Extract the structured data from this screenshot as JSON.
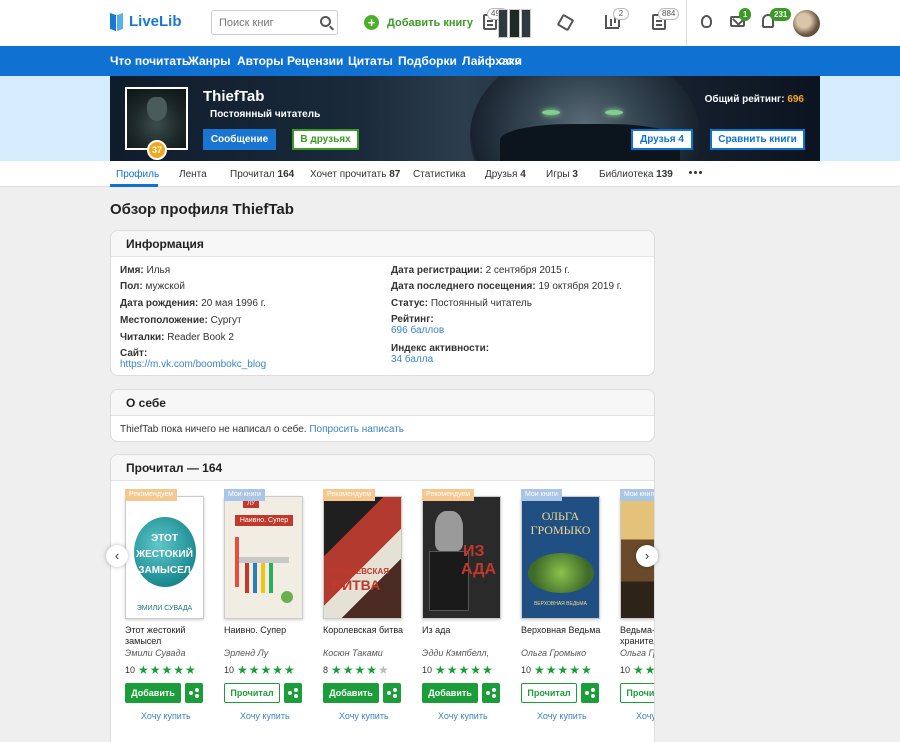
{
  "header": {
    "logo": "LiveLib",
    "search_placeholder": "Поиск книг",
    "add_book": "Добавить книгу",
    "counts": {
      "reading": "495",
      "stats": "2",
      "docs": "884"
    },
    "badges": {
      "mail": "1",
      "notifications": "231"
    }
  },
  "nav": {
    "items": [
      "Что почитать",
      "Жанры",
      "Авторы",
      "Рецензии",
      "Цитаты",
      "Подборки",
      "Лайфхаки"
    ]
  },
  "profile": {
    "username": "ThiefTab",
    "status": "Постоянный читатель",
    "level": "37",
    "message_button": "Сообщение",
    "friend_button": "В друзьях",
    "rating_label": "Общий рейтинг:",
    "rating_value": "696",
    "friends_button": "Друзья 4",
    "compare_button": "Сравнить книги"
  },
  "tabs": [
    {
      "label": "Профиль",
      "count": ""
    },
    {
      "label": "Лента",
      "count": ""
    },
    {
      "label": "Прочитал",
      "count": "164"
    },
    {
      "label": "Хочет прочитать",
      "count": "87"
    },
    {
      "label": "Статистика",
      "count": ""
    },
    {
      "label": "Друзья",
      "count": "4"
    },
    {
      "label": "Игры",
      "count": "3"
    },
    {
      "label": "Библиотека",
      "count": "139"
    }
  ],
  "page_title": "Обзор профиля ThiefTab",
  "info": {
    "heading": "Информация",
    "name": {
      "label": "Имя:",
      "value": "Илья"
    },
    "gender": {
      "label": "Пол:",
      "value": "мужской"
    },
    "birthday": {
      "label": "Дата рождения:",
      "value": "20 мая 1996 г."
    },
    "location": {
      "label": "Местоположение:",
      "value": "Сургут"
    },
    "readers": {
      "label": "Читалки:",
      "value": "Reader Book 2"
    },
    "site": {
      "label": "Сайт:",
      "value": "https://m.vk.com/boombokc_blog"
    },
    "registered": {
      "label": "Дата регистрации:",
      "value": "2 сентября 2015 г."
    },
    "last_visit": {
      "label": "Дата последнего посещения:",
      "value": "19 октября 2019 г."
    },
    "status": {
      "label": "Статус:",
      "value": "Постоянный читатель"
    },
    "rating": {
      "label": "Рейтинг:",
      "value": "696 баллов"
    },
    "activity": {
      "label": "Индекс активности:",
      "value": "34 балла"
    }
  },
  "about": {
    "heading": "О себе",
    "text": "ThiefTab пока ничего не написал о себе.",
    "link": "Попросить написать"
  },
  "read": {
    "heading": "Прочитал — 164",
    "books": [
      {
        "ribbon": "Рекомендуем",
        "title": "Этот жестокий замысел",
        "author": "Эмили Сувада",
        "score": "10",
        "stars": 5,
        "action": "Добавить",
        "buy": "Хочу купить",
        "cover_lines": [
          "ЭТОТ",
          "ЖЕСТОКИЙ",
          "ЗАМЫСЕЛ"
        ],
        "cover_author": "ЭМИЛИ СУВАДА"
      },
      {
        "ribbon": "Мои книги",
        "title": "Наивно. Супер",
        "author": "Эрленд Лу",
        "score": "10",
        "stars": 5,
        "action": "Прочитал",
        "buy": "Хочу купить",
        "cover_lines": [
          "Наивно. Супер"
        ],
        "cover_author": "ЛУ"
      },
      {
        "ribbon": "Рекомендуем",
        "title": "Королевская битва",
        "author": "Косюн Таками",
        "score": "8",
        "stars": 4,
        "action": "Добавить",
        "buy": "Хочу купить",
        "cover_lines": [
          "КОРОЛЕВСКАЯ",
          "БИТВА"
        ],
        "cover_author": ""
      },
      {
        "ribbon": "Рекомендуем",
        "title": "Из ада",
        "author": "Эдди Кэмпбелл,",
        "score": "10",
        "stars": 5,
        "action": "Добавить",
        "buy": "Хочу купить",
        "cover_lines": [
          "ИЗ",
          "АДА"
        ],
        "cover_author": ""
      },
      {
        "ribbon": "Мои книги",
        "title": "Верховная Ведьма",
        "author": "Ольга Громыко",
        "score": "10",
        "stars": 5,
        "action": "Прочитал",
        "buy": "Хочу купить",
        "cover_lines": [
          "ОЛЬГА",
          "ГРОМЫКО"
        ],
        "cover_author": "ВЕРХОВНАЯ ВЕДЬМА"
      },
      {
        "ribbon": "Мои книги",
        "title": "Ведьма-хранительница",
        "author": "Ольга Громыко",
        "score": "10",
        "stars": 5,
        "action": "Прочитал",
        "buy": "Хочу купить",
        "cover_lines": [],
        "cover_author": ""
      }
    ]
  },
  "colors": {
    "brand_blue": "#0f72d3",
    "green": "#1b9e3a",
    "orange": "#f2a71f"
  }
}
